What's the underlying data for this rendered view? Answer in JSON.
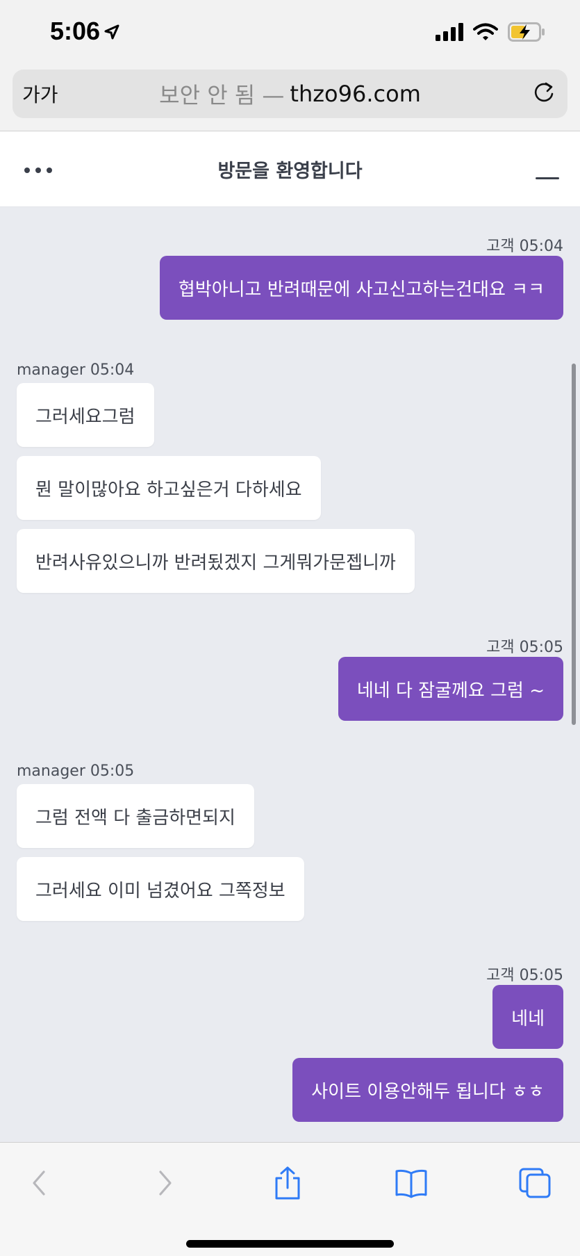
{
  "status_bar": {
    "time": "5:06",
    "icons": [
      "location-arrow-icon",
      "signal-icon",
      "wifi-icon",
      "battery-charging-icon"
    ]
  },
  "address_bar": {
    "text_size_label": "가가",
    "insecure_label": "보안 안 됨 —",
    "domain": "thzo96.com"
  },
  "chat": {
    "title": "방문을 환영합니다",
    "groups": [
      {
        "meta": "고객 05:04",
        "side": "out",
        "messages": [
          "협박아니고 반려때문에 사고신고하는건대요 ㅋㅋ"
        ]
      },
      {
        "meta": "manager 05:04",
        "side": "in",
        "messages": [
          "그러세요그럼",
          "뭔 말이많아요 하고싶은거 다하세요",
          "반려사유있으니까 반려됬겠지 그게뭐가문젭니까"
        ]
      },
      {
        "meta": "고객 05:05",
        "side": "out",
        "messages": [
          "네네 다 잠굴께요 그럼 ~"
        ]
      },
      {
        "meta": "manager 05:05",
        "side": "in",
        "messages": [
          "그럼 전액 다 출금하면되지",
          "그러세요 이미 넘겼어요 그쪽정보"
        ]
      },
      {
        "meta": "고객 05:05",
        "side": "out",
        "messages": [
          "네네",
          "사이트 이용안해두 됩니다 ㅎㅎ"
        ]
      }
    ]
  },
  "toolbar": {
    "buttons": [
      "back-icon",
      "forward-icon",
      "share-icon",
      "bookmarks-icon",
      "tabs-icon"
    ]
  },
  "colors": {
    "outgoing_bubble": "#7b4fbd",
    "incoming_bubble": "#ffffff",
    "chat_background": "#e9ebf0",
    "ios_blue": "#2f7bf6"
  }
}
